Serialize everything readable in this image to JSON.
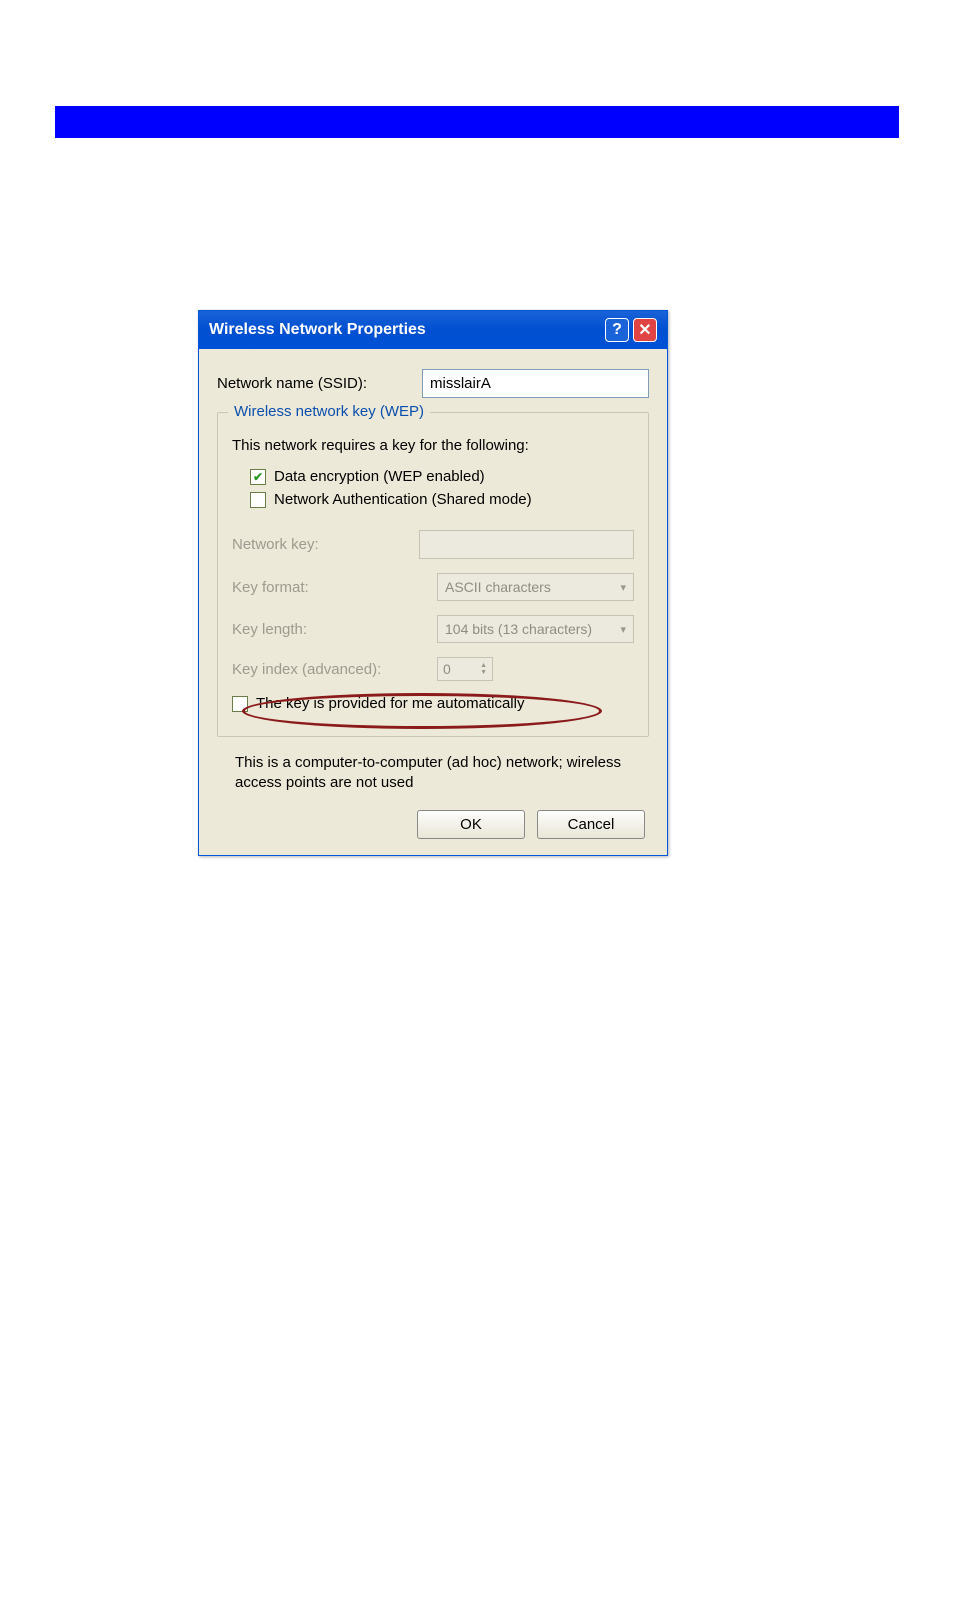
{
  "dialog": {
    "title": "Wireless Network Properties",
    "ssid_label": "Network name (SSID):",
    "ssid_value": "misslairA",
    "group_title": "Wireless network key (WEP)",
    "requires_text": "This network requires a key for the following:",
    "chk_wep_label": "Data encryption (WEP enabled)",
    "chk_auth_label": "Network Authentication (Shared mode)",
    "netkey_label": "Network key:",
    "keyformat_label": "Key format:",
    "keyformat_value": "ASCII characters",
    "keylength_label": "Key length:",
    "keylength_value": "104 bits (13 characters)",
    "keyindex_label": "Key index (advanced):",
    "keyindex_value": "0",
    "chk_auto_label": "The key is provided for me automatically",
    "adhoc_text": "This is a computer-to-computer (ad hoc) network; wireless access points are not used",
    "ok_label": "OK",
    "cancel_label": "Cancel"
  }
}
